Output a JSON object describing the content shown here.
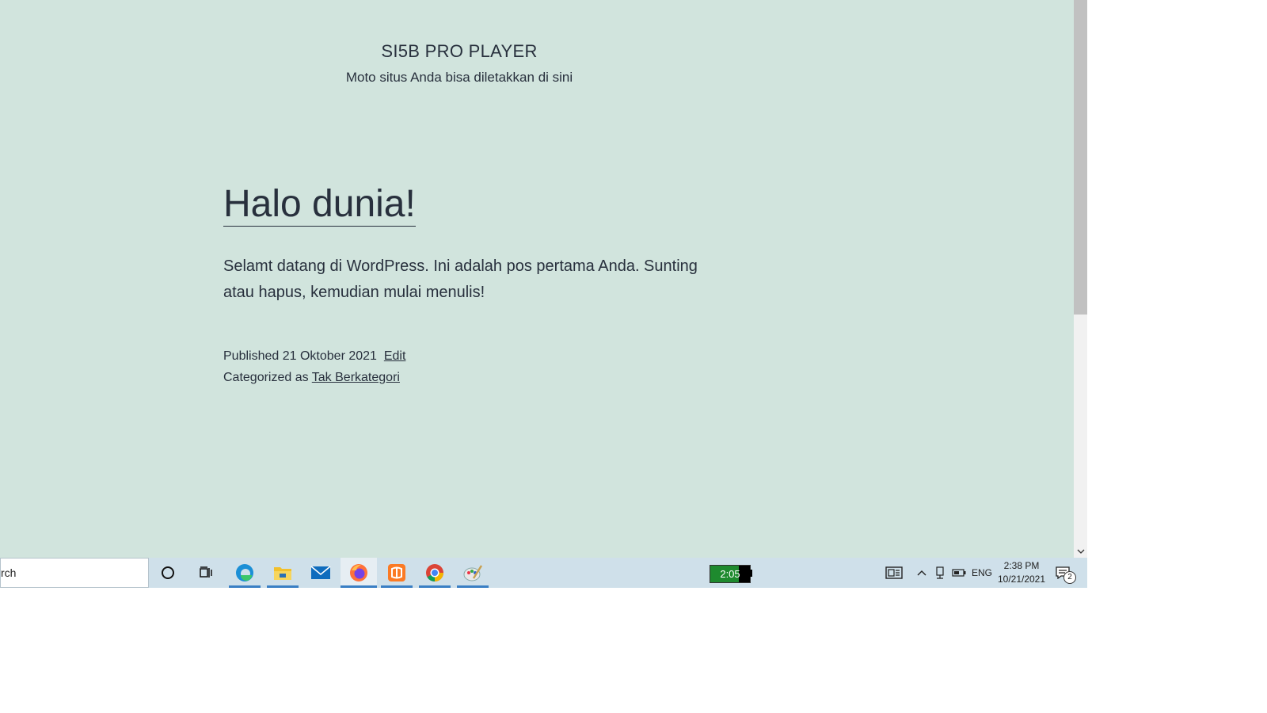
{
  "site": {
    "title": "SI5B PRO PLAYER",
    "tagline": "Moto situs Anda bisa diletakkan di sini"
  },
  "post": {
    "title": "Halo dunia!",
    "body": "Selamt datang di WordPress. Ini adalah pos pertama Anda. Sunting atau hapus, kemudian mulai menulis!",
    "published_label": "Published",
    "published_date": "21 Oktober 2021",
    "edit_link": "Edit",
    "categorized_label": "Categorized as",
    "category_link": "Tak Berkategori"
  },
  "colors": {
    "page_background": "#d1e4dd",
    "text": "#28303d",
    "taskbar": "#cfe0ea",
    "taskbar_underline": "#3a7fc4"
  },
  "taskbar": {
    "search_text": "rch",
    "apps": [
      "edge-icon",
      "file-explorer-icon",
      "mail-icon",
      "firefox-icon",
      "xampp-icon",
      "chrome-icon",
      "paint-icon"
    ],
    "active_app": "firefox-icon",
    "battery_widget_text": "2:05",
    "language": "ENG",
    "time": "2:38 PM",
    "date": "10/21/2021",
    "notification_count": "2"
  }
}
